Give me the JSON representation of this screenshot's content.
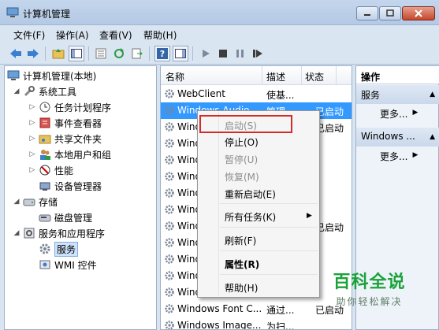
{
  "window": {
    "title": "计算机管理"
  },
  "menubar": [
    "文件(F)",
    "操作(A)",
    "查看(V)",
    "帮助(H)"
  ],
  "tree": {
    "root": "计算机管理(本地)",
    "items": [
      {
        "label": "系统工具"
      },
      {
        "label": "任务计划程序"
      },
      {
        "label": "事件查看器"
      },
      {
        "label": "共享文件夹"
      },
      {
        "label": "本地用户和组"
      },
      {
        "label": "性能"
      },
      {
        "label": "设备管理器"
      },
      {
        "label": "存储"
      },
      {
        "label": "磁盘管理"
      },
      {
        "label": "服务和应用程序"
      },
      {
        "label": "服务"
      },
      {
        "label": "WMI 控件"
      }
    ]
  },
  "services": {
    "columns": [
      "名称",
      "描述",
      "状态"
    ],
    "rows": [
      {
        "name": "WebClient",
        "desc": "使基...",
        "status": ""
      },
      {
        "name": "Windows Audio",
        "desc": "管理...",
        "status": "已启动"
      },
      {
        "name": "Wind",
        "desc": "",
        "status": "已启动"
      },
      {
        "name": "Wind",
        "desc": "",
        "status": ""
      },
      {
        "name": "Wind",
        "desc": "",
        "status": ""
      },
      {
        "name": "Wind",
        "desc": "",
        "status": ""
      },
      {
        "name": "Wind",
        "desc": "",
        "status": ""
      },
      {
        "name": "Wind",
        "desc": "",
        "status": ""
      },
      {
        "name": "Wind",
        "desc": "",
        "status": "已启动"
      },
      {
        "name": "Wind",
        "desc": "",
        "status": ""
      },
      {
        "name": "Wind",
        "desc": "",
        "status": ""
      },
      {
        "name": "Wind",
        "desc": "",
        "status": ""
      },
      {
        "name": "Wind",
        "desc": "",
        "status": ""
      },
      {
        "name": "Windows Font C...",
        "desc": "通过...",
        "status": "已启动"
      },
      {
        "name": "Windows Image...",
        "desc": "为扫...",
        "status": ""
      }
    ]
  },
  "actions": {
    "header": "操作",
    "sections": [
      {
        "title": "服务",
        "more": "更多..."
      },
      {
        "title": "Windows ...",
        "more": "更多..."
      }
    ]
  },
  "context_menu": {
    "items": [
      "启动(S)",
      "停止(O)",
      "暂停(U)",
      "恢复(M)",
      "重新启动(E)",
      "所有任务(K)",
      "刷新(F)",
      "属性(R)",
      "帮助(H)"
    ],
    "disabled": [
      "启动(S)",
      "暂停(U)",
      "恢复(M)"
    ]
  },
  "watermark": {
    "title": "百科全说",
    "subtitle": "助你轻松解决"
  },
  "colors": {
    "selection": "#3399ff",
    "highlight_box": "#d42a2a",
    "watermark": "#1aa23a"
  }
}
